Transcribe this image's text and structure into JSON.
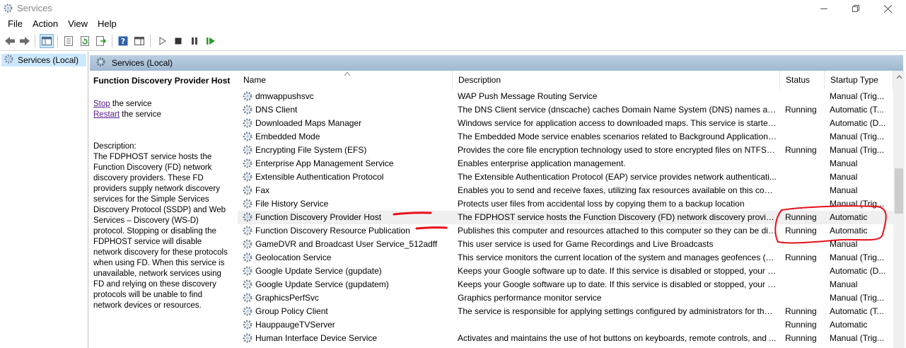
{
  "window": {
    "title": "Services"
  },
  "menu": [
    "File",
    "Action",
    "View",
    "Help"
  ],
  "tree": {
    "selected": "Services (Local)"
  },
  "header": {
    "title": "Services (Local)"
  },
  "detail": {
    "service_name": "Function Discovery Provider Host",
    "stop_link": "Stop",
    "stop_suffix": " the service",
    "restart_link": "Restart",
    "restart_suffix": " the service",
    "description_label": "Description:",
    "description_text": "The FDPHOST service hosts the Function Discovery (FD) network discovery providers. These FD providers supply network discovery services for the Simple Services Discovery Protocol (SSDP) and Web Services – Discovery (WS-D) protocol. Stopping or disabling the FDPHOST service will disable network discovery for these protocols when using FD. When this service is unavailable, network services using FD and relying on these discovery protocols will be unable to find network devices or resources."
  },
  "columns": {
    "name": "Name",
    "description": "Description",
    "status": "Status",
    "startup": "Startup Type"
  },
  "services": [
    {
      "name": "dmwappushsvc",
      "description": "WAP Push Message Routing Service",
      "status": "",
      "startup": "Manual (Trig..."
    },
    {
      "name": "DNS Client",
      "description": "The DNS Client service (dnscache) caches Domain Name System (DNS) names and r...",
      "status": "Running",
      "startup": "Automatic (T..."
    },
    {
      "name": "Downloaded Maps Manager",
      "description": "Windows service for application access to downloaded maps. This service is started ...",
      "status": "",
      "startup": "Automatic (D..."
    },
    {
      "name": "Embedded Mode",
      "description": "The Embedded Mode service enables scenarios related to Background Applications....",
      "status": "",
      "startup": "Manual (Trig..."
    },
    {
      "name": "Encrypting File System (EFS)",
      "description": "Provides the core file encryption technology used to store encrypted files on NTFS fi...",
      "status": "Running",
      "startup": "Manual (Trig..."
    },
    {
      "name": "Enterprise App Management Service",
      "description": "Enables enterprise application management.",
      "status": "",
      "startup": "Manual"
    },
    {
      "name": "Extensible Authentication Protocol",
      "description": "The Extensible Authentication Protocol (EAP) service provides network authenticati...",
      "status": "",
      "startup": "Manual"
    },
    {
      "name": "Fax",
      "description": "Enables you to send and receive faxes, utilizing fax resources available on this comp...",
      "status": "",
      "startup": "Manual"
    },
    {
      "name": "File History Service",
      "description": "Protects user files from accidental loss by copying them to a backup location",
      "status": "",
      "startup": "Manual (Trig..."
    },
    {
      "name": "Function Discovery Provider Host",
      "description": "The FDPHOST service hosts the Function Discovery (FD) network discovery provider...",
      "status": "Running",
      "startup": "Automatic"
    },
    {
      "name": "Function Discovery Resource Publication",
      "description": "Publishes this computer and resources attached to this computer so they can be dis...",
      "status": "Running",
      "startup": "Automatic"
    },
    {
      "name": "GameDVR and Broadcast User Service_512adff",
      "description": "This user service is used for Game Recordings and Live Broadcasts",
      "status": "",
      "startup": "Manual"
    },
    {
      "name": "Geolocation Service",
      "description": "This service monitors the current location of the system and manages geofences (a ...",
      "status": "Running",
      "startup": "Manual (Trig..."
    },
    {
      "name": "Google Update Service (gupdate)",
      "description": "Keeps your Google software up to date. If this service is disabled or stopped, your G...",
      "status": "",
      "startup": "Automatic (D..."
    },
    {
      "name": "Google Update Service (gupdatem)",
      "description": "Keeps your Google software up to date. If this service is disabled or stopped, your G...",
      "status": "",
      "startup": "Manual"
    },
    {
      "name": "GraphicsPerfSvc",
      "description": "Graphics performance monitor service",
      "status": "",
      "startup": "Manual (Trig..."
    },
    {
      "name": "Group Policy Client",
      "description": "The service is responsible for applying settings configured by administrators for the ...",
      "status": "Running",
      "startup": "Automatic (T..."
    },
    {
      "name": "HauppaugeTVServer",
      "description": "",
      "status": "Running",
      "startup": "Automatic"
    },
    {
      "name": "Human Interface Device Service",
      "description": "Activates and maintains the use of hot buttons on keyboards, remote controls, and ...",
      "status": "Running",
      "startup": "Manual (Trig..."
    }
  ],
  "selected_index": 9,
  "colors": {
    "annotation": "#e8101a",
    "header_band": "#bccfe1",
    "link": "#551a8b"
  }
}
